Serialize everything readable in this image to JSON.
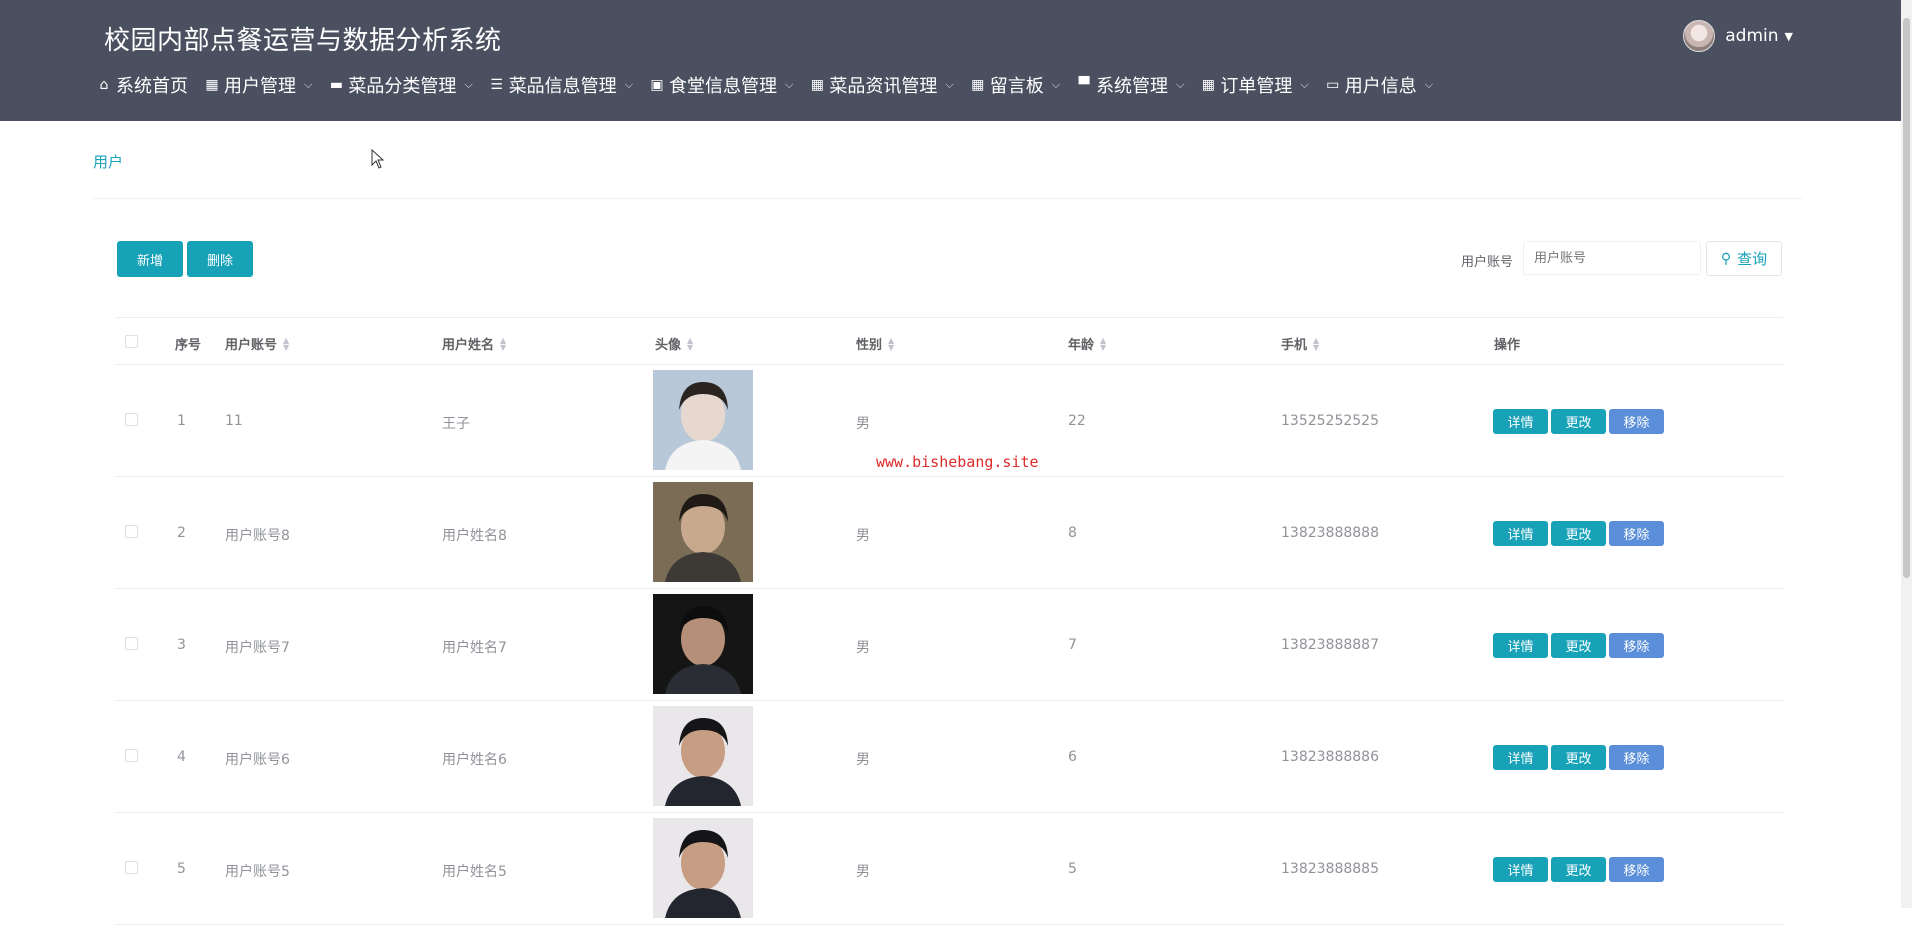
{
  "app": {
    "title": "校园内部点餐运营与数据分析系统",
    "user": "admin"
  },
  "nav": [
    {
      "label": "系统首页",
      "icon": "home-icon",
      "glyph": "⌂",
      "chevron": false
    },
    {
      "label": "用户管理",
      "icon": "grid-icon",
      "glyph": "▦",
      "chevron": true
    },
    {
      "label": "菜品分类管理",
      "icon": "briefcase-icon",
      "glyph": "▬",
      "chevron": true
    },
    {
      "label": "菜品信息管理",
      "icon": "list-icon",
      "glyph": "☰",
      "chevron": true
    },
    {
      "label": "食堂信息管理",
      "icon": "clipboard-icon",
      "glyph": "▣",
      "chevron": true
    },
    {
      "label": "菜品资讯管理",
      "icon": "grid-icon",
      "glyph": "▦",
      "chevron": true
    },
    {
      "label": "留言板",
      "icon": "grid-icon",
      "glyph": "▦",
      "chevron": true
    },
    {
      "label": "系统管理",
      "icon": "monitor-icon",
      "glyph": "▀",
      "chevron": true
    },
    {
      "label": "订单管理",
      "icon": "grid-icon",
      "glyph": "▦",
      "chevron": true
    },
    {
      "label": "用户信息",
      "icon": "card-icon",
      "glyph": "▭",
      "chevron": true
    }
  ],
  "breadcrumb": "用户",
  "toolbar": {
    "add": "新增",
    "delete": "删除",
    "search_label": "用户账号",
    "search_placeholder": "用户账号",
    "search_button": "查询"
  },
  "table": {
    "columns": {
      "index": "序号",
      "account": "用户账号",
      "name": "用户姓名",
      "avatar": "头像",
      "gender": "性别",
      "age": "年龄",
      "phone": "手机",
      "ops": "操作"
    },
    "actions": {
      "detail": "详情",
      "edit": "更改",
      "remove": "移除"
    },
    "rows": [
      {
        "index": "1",
        "account": "11",
        "name": "王子",
        "gender": "男",
        "age": "22",
        "phone": "13525252525"
      },
      {
        "index": "2",
        "account": "用户账号8",
        "name": "用户姓名8",
        "gender": "男",
        "age": "8",
        "phone": "13823888888"
      },
      {
        "index": "3",
        "account": "用户账号7",
        "name": "用户姓名7",
        "gender": "男",
        "age": "7",
        "phone": "13823888887"
      },
      {
        "index": "4",
        "account": "用户账号6",
        "name": "用户姓名6",
        "gender": "男",
        "age": "6",
        "phone": "13823888886"
      },
      {
        "index": "5",
        "account": "用户账号5",
        "name": "用户姓名5",
        "gender": "男",
        "age": "5",
        "phone": "13823888885"
      }
    ]
  },
  "watermark": "www.bishebang.site",
  "colors": {
    "header_bg": "#4a5060",
    "accent": "#17a2b8",
    "remove_btn": "#5b8fd9",
    "watermark": "#e02b2b"
  }
}
